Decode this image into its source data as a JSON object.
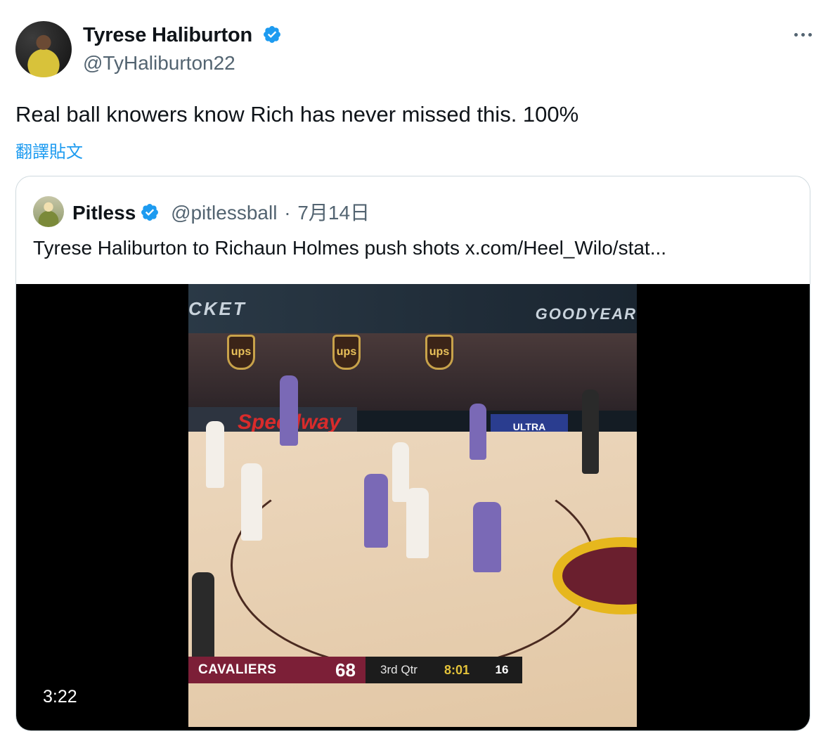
{
  "tweet": {
    "author_name": "Tyrese Haliburton",
    "author_handle": "@TyHaliburton22",
    "text": "Real ball knowers know Rich has never missed this. 100%",
    "translate_label": "翻譯貼文",
    "verified": true
  },
  "quoted": {
    "author_name": "Pitless",
    "author_handle": "@pitlessball",
    "separator": "·",
    "date": "7月14日",
    "text": "Tyrese Haliburton to Richaun Holmes push shots  x.com/Heel_Wilo/stat...",
    "video": {
      "duration": "3:22",
      "scoreboard": {
        "team": "CAVALIERS",
        "points": "68",
        "quarter": "3rd Qtr",
        "clock": "8:01",
        "shot_clock": "16"
      },
      "arena_text": {
        "rocket": "CKET",
        "goodyear": "GOODYEAR",
        "speedway": "Speedway",
        "ultra": "ULTRA",
        "ups": "ups"
      }
    }
  },
  "colors": {
    "link": "#1d9bf0",
    "secondary_text": "#536471",
    "verified_badge": "#1d9bf0",
    "cavaliers_wine": "#7c1f37"
  },
  "icons": {
    "more": "more-horizontal-icon",
    "verified": "verified-badge-icon"
  }
}
